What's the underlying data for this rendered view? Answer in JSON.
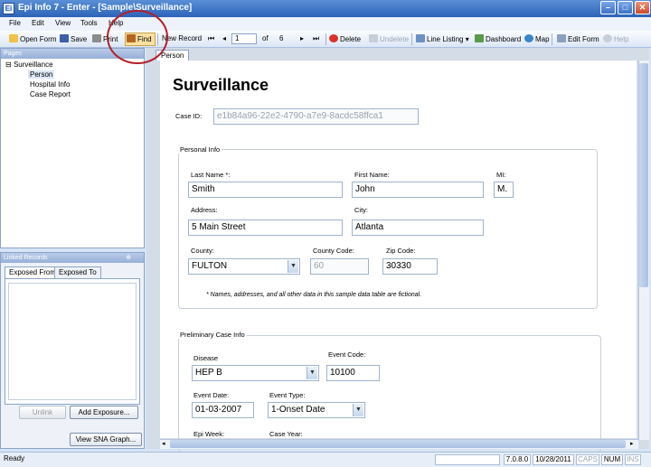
{
  "window": {
    "title": "Epi Info 7 - Enter - [Sample\\Surveillance]",
    "icon_text": "Ei"
  },
  "menu": [
    "File",
    "Edit",
    "View",
    "Tools",
    "Help"
  ],
  "toolbar": {
    "open_form": "Open Form",
    "save": "Save",
    "print": "Print",
    "find": "Find",
    "new_record": "New Record",
    "record_current": "1",
    "of_label": "of",
    "record_total": "6",
    "delete": "Delete",
    "undelete": "Undelete",
    "line_listing": "Line Listing",
    "dashboard": "Dashboard",
    "map": "Map",
    "edit_form": "Edit Form",
    "help": "Help"
  },
  "pages_panel": {
    "header": "Pages",
    "root": "Surveillance",
    "items": [
      "Person",
      "Hospital Info",
      "Case Report"
    ]
  },
  "linked_panel": {
    "header": "Linked Records",
    "tabs": [
      "Exposed From",
      "Exposed To"
    ],
    "unlink": "Unlink",
    "add_exposure": "Add Exposure...",
    "sna_graph": "View SNA Graph..."
  },
  "form": {
    "tab": "Person",
    "title": "Surveillance",
    "case_id_label": "Case ID:",
    "case_id": "e1b84a96-22e2-4790-a7e9-8acdc58ffca1",
    "personal_info": {
      "title": "Personal Info",
      "last_name_label": "Last Name *:",
      "last_name": "Smith",
      "first_name_label": "First Name:",
      "first_name": "John",
      "mi_label": "MI:",
      "mi": "M.",
      "address_label": "Address:",
      "address": "5 Main Street",
      "city_label": "City:",
      "city": "Atlanta",
      "county_label": "County:",
      "county": "FULTON",
      "county_code_label": "County Code:",
      "county_code": "60",
      "zip_label": "Zip Code:",
      "zip": "30330",
      "note": "* Names, addresses, and all other data in this sample data table are fictional."
    },
    "preliminary": {
      "title": "Preliminary Case Info",
      "disease_label": "Disease",
      "disease": "HEP B",
      "event_code_label": "Event Code:",
      "event_code": "10100",
      "event_date_label": "Event Date:",
      "event_date": "01-03-2007",
      "event_type_label": "Event Type:",
      "event_type": "1-Onset Date",
      "epi_week_label": "Epi Week:",
      "case_year_label": "Case Year:"
    }
  },
  "status": {
    "ready": "Ready",
    "version": "7.0.8.0",
    "date": "10/28/2011",
    "caps": "CAPS",
    "num": "NUM",
    "ins": "INS"
  }
}
